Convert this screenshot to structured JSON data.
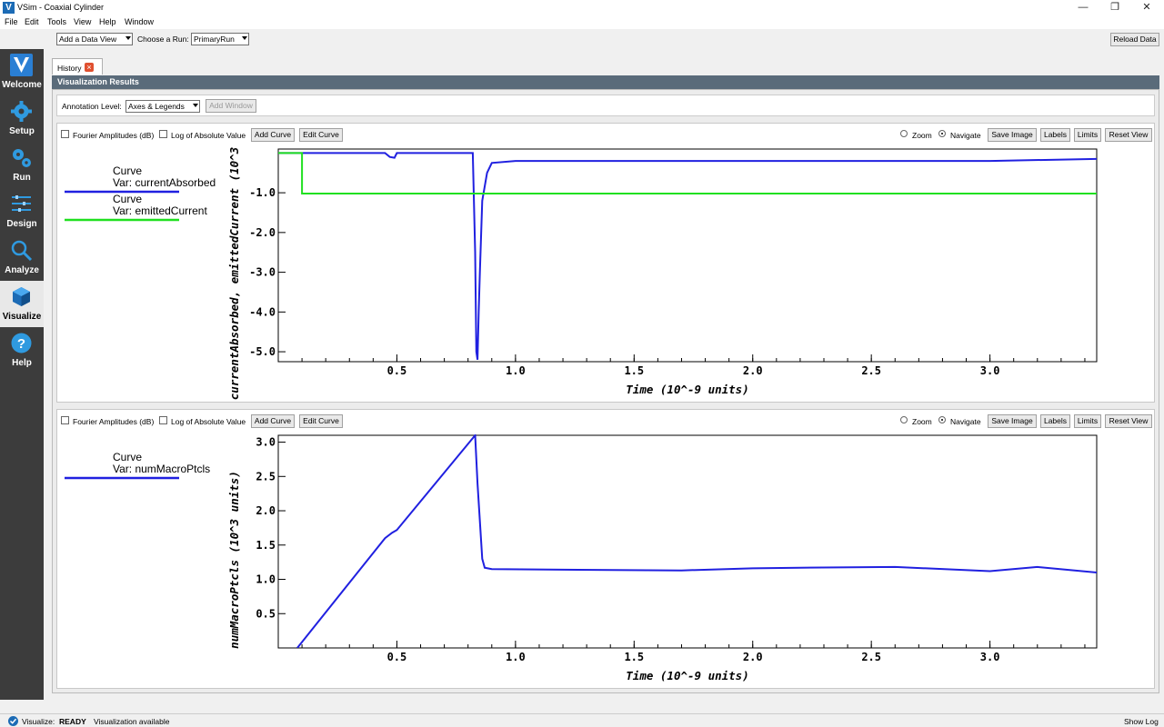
{
  "window": {
    "title": "VSim - Coaxial Cylinder",
    "app_icon": "V"
  },
  "menu": [
    "File",
    "Edit",
    "Tools",
    "View",
    "Help",
    "Window"
  ],
  "toolbar": {
    "data_view_combo": "Add a Data View",
    "choose_run_label": "Choose a Run:",
    "choose_run_value": "PrimaryRun",
    "reload_button": "Reload Data"
  },
  "sidebar": [
    {
      "label": "Welcome",
      "icon": "vsim-logo-icon",
      "active": false
    },
    {
      "label": "Setup",
      "icon": "gear-icon",
      "active": false
    },
    {
      "label": "Run",
      "icon": "gears-icon",
      "active": false
    },
    {
      "label": "Design",
      "icon": "design-icon",
      "active": false
    },
    {
      "label": "Analyze",
      "icon": "magnifier-icon",
      "active": false
    },
    {
      "label": "Visualize",
      "icon": "cube-icon",
      "active": true
    },
    {
      "label": "Help",
      "icon": "help-icon",
      "active": false
    }
  ],
  "tab": {
    "label": "History"
  },
  "results_header": "Visualization Results",
  "annotation": {
    "label": "Annotation Level:",
    "value": "Axes & Legends",
    "add_window": "Add Window"
  },
  "plot_toolbar": {
    "fourier": "Fourier Amplitudes (dB)",
    "log_abs": "Log of Absolute Value",
    "add_curve": "Add Curve",
    "edit_curve": "Edit Curve",
    "zoom": "Zoom",
    "navigate": "Navigate",
    "save_image": "Save Image",
    "labels": "Labels",
    "limits": "Limits",
    "reset_view": "Reset View"
  },
  "chart_data": [
    {
      "type": "line",
      "xlabel": "Time (10^-9 units)",
      "ylabel": "currentAbsorbed, emittedCurrent (10^3",
      "xlim": [
        0.0,
        3.45
      ],
      "ylim": [
        -5.25,
        0.1
      ],
      "xticks": [
        "0.5",
        "1.0",
        "1.5",
        "2.0",
        "2.5",
        "3.0"
      ],
      "yticks": [
        "-1.0",
        "-2.0",
        "-3.0",
        "-4.0",
        "-5.0"
      ],
      "legend": [
        {
          "title": "Curve",
          "var": "Var: currentAbsorbed",
          "color": "#2020e0"
        },
        {
          "title": "Curve",
          "var": "Var: emittedCurrent",
          "color": "#20e020"
        }
      ],
      "series": [
        {
          "name": "currentAbsorbed",
          "color": "#2020e0",
          "x": [
            0.0,
            0.45,
            0.47,
            0.49,
            0.5,
            0.82,
            0.83,
            0.835,
            0.84,
            0.845,
            0.85,
            0.86,
            0.88,
            0.9,
            1.0,
            1.5,
            2.0,
            2.5,
            3.0,
            3.45
          ],
          "y": [
            0.0,
            0.0,
            -0.1,
            -0.12,
            0.0,
            0.0,
            -2.5,
            -5.0,
            -5.2,
            -4.0,
            -3.0,
            -1.2,
            -0.5,
            -0.25,
            -0.2,
            -0.2,
            -0.2,
            -0.2,
            -0.2,
            -0.15
          ]
        },
        {
          "name": "emittedCurrent",
          "color": "#20e020",
          "x": [
            0.0,
            0.1,
            0.1,
            3.45
          ],
          "y": [
            0.0,
            0.0,
            -1.02,
            -1.02
          ]
        }
      ]
    },
    {
      "type": "line",
      "xlabel": "Time (10^-9 units)",
      "ylabel": "numMacroPtcls (10^3 units)",
      "xlim": [
        0.0,
        3.45
      ],
      "ylim": [
        0.0,
        3.1
      ],
      "xticks": [
        "0.5",
        "1.0",
        "1.5",
        "2.0",
        "2.5",
        "3.0"
      ],
      "yticks": [
        "0.5",
        "1.0",
        "1.5",
        "2.0",
        "2.5",
        "3.0"
      ],
      "legend": [
        {
          "title": "Curve",
          "var": "Var: numMacroPtcls",
          "color": "#2020e0"
        }
      ],
      "series": [
        {
          "name": "numMacroPtcls",
          "color": "#2020e0",
          "x": [
            0.08,
            0.45,
            0.48,
            0.5,
            0.83,
            0.84,
            0.86,
            0.87,
            0.9,
            1.2,
            1.7,
            2.0,
            2.2,
            2.6,
            3.0,
            3.2,
            3.45
          ],
          "y": [
            0.0,
            1.6,
            1.68,
            1.72,
            3.1,
            2.4,
            1.3,
            1.17,
            1.15,
            1.14,
            1.13,
            1.16,
            1.17,
            1.18,
            1.12,
            1.18,
            1.1
          ]
        }
      ]
    }
  ],
  "status": {
    "label": "Visualize:",
    "state": "READY",
    "message": "Visualization available",
    "show_log": "Show Log"
  }
}
